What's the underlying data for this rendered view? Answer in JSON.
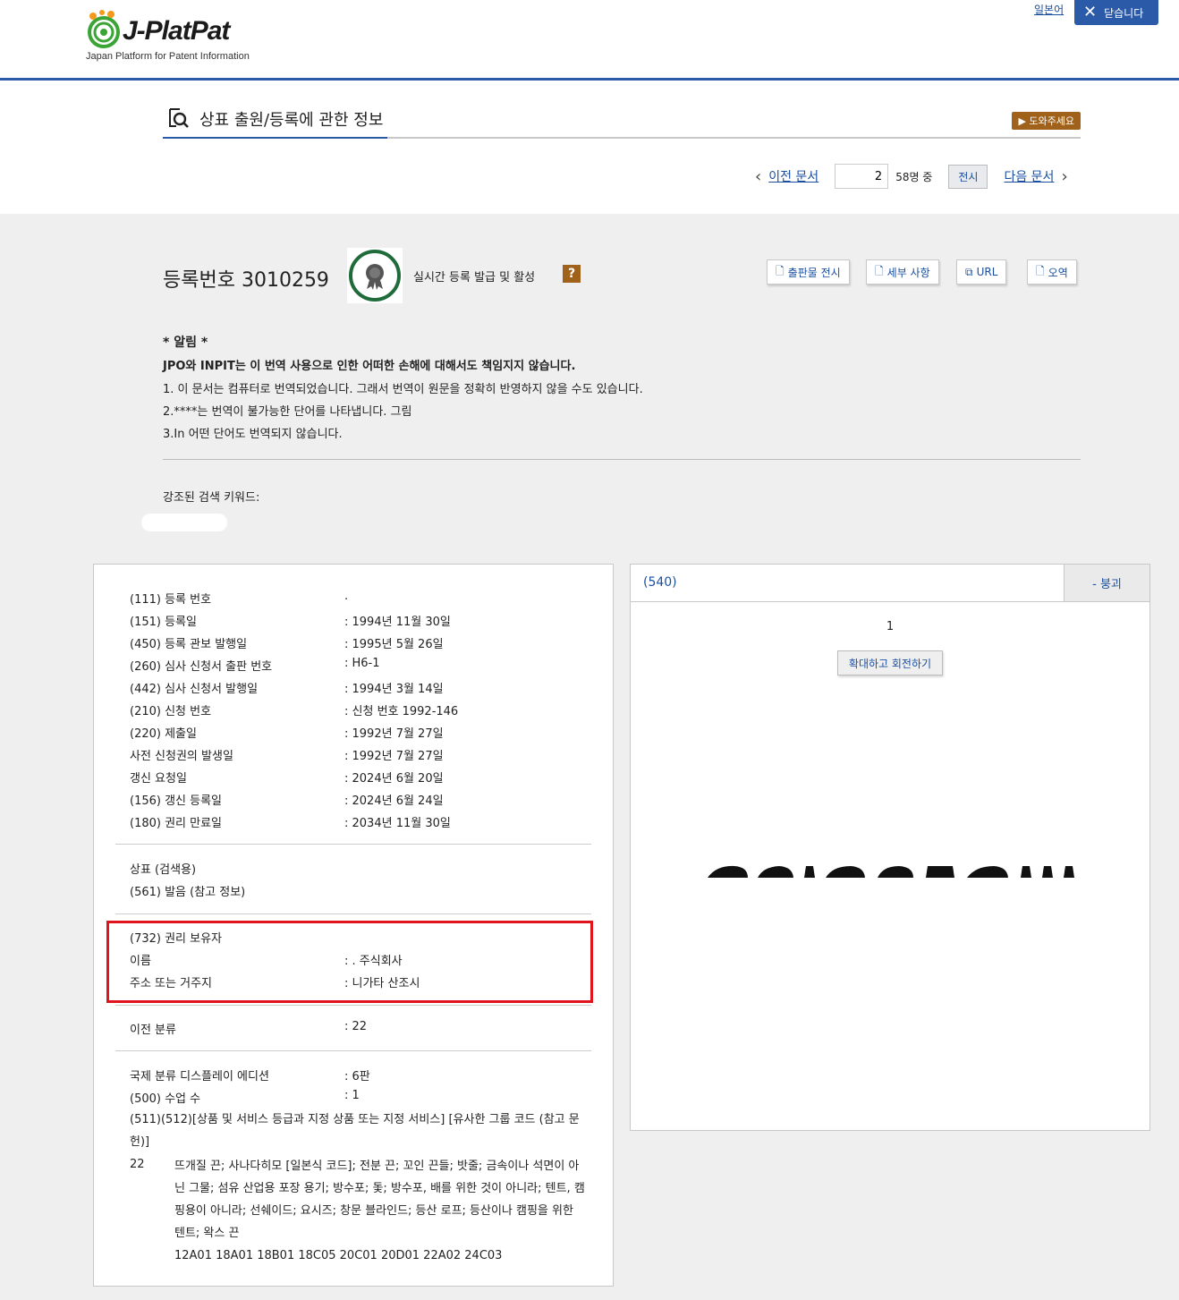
{
  "header": {
    "logo_text": "J-PlatPat",
    "logo_subtitle": "Japan Platform for Patent Information",
    "lang_link": "일본어",
    "close_label": "닫습니다"
  },
  "page": {
    "title": "상표 출원/등록에 관한 정보",
    "help_label": "▶ 도와주세요"
  },
  "pager": {
    "prev_label": "이전 문서",
    "current": "2",
    "of_label": "58명 중",
    "show_label": "전시",
    "next_label": "다음 문서"
  },
  "record": {
    "registration_title": "등록번호 3010259",
    "live_text": "실시간 등록 발급 및 활성",
    "q_mark": "?",
    "actions": [
      "출판물 전시",
      "세부 사항",
      "URL",
      "오역"
    ]
  },
  "notice": {
    "heading": "* 알림 *",
    "bold_line": "JPO와 INPIT는 이 번역 사용으로 인한 어떠한 손해에 대해서도 책임지지 않습니다.",
    "lines": [
      "1. 이 문서는 컴퓨터로 번역되었습니다. 그래서 번역이 원문을 정확히 반영하지 않을 수도 있습니다.",
      "2.****는 번역이 불가능한 단어를 나타냅니다. 그림",
      "3.In 어떤 단어도 번역되지 않습니다."
    ]
  },
  "keywords": {
    "label": "강조된 검색 키워드:"
  },
  "details": {
    "rows": [
      {
        "label": "(111) 등록 번호",
        "value": "."
      },
      {
        "label": "(151) 등록일",
        "value": ": 1994년 11월 30일"
      },
      {
        "label": "(450) 등록 관보 발행일",
        "value": ": 1995년 5월 26일"
      },
      {
        "label": "(260) 심사 신청서 출판 번호",
        "value": ": H6-1"
      },
      {
        "label": "(442) 심사 신청서 발행일",
        "value": ": 1994년 3월 14일"
      },
      {
        "label": "(210) 신청 번호",
        "value": ": 신청 번호 1992-146"
      },
      {
        "label": "(220) 제출일",
        "value": ": 1992년 7월 27일"
      },
      {
        "label": "사전 신청권의 발생일",
        "value": ": 1992년 7월 27일"
      },
      {
        "label": "갱신 요청일",
        "value": ": 2024년 6월 20일"
      },
      {
        "label": "(156) 갱신 등록일",
        "value": ": 2024년 6월 24일"
      },
      {
        "label": "(180) 권리 만료일",
        "value": ": 2034년 11월 30일"
      }
    ],
    "mark_rows": [
      {
        "label": "상표 (검색용)",
        "value": ""
      },
      {
        "label": "(561) 발음 (참고 정보)",
        "value": ""
      }
    ],
    "holder": {
      "heading": "(732) 권리 보유자",
      "name_label": "이름",
      "name_value": ":                    . 주식회사",
      "address_label": "주소 또는 거주지",
      "address_value": ": 니가타 산조시"
    },
    "prior_class": {
      "label": "이전 분류",
      "value": ": 22"
    },
    "intl": [
      {
        "label": "국제 분류 디스플레이 에디션",
        "value": ": 6판"
      },
      {
        "label": "(500) 수업 수",
        "value": ": 1"
      }
    ],
    "goods_heading": "(511)(512)[상품 및 서비스 등급과 지정 상품 또는 지정 서비스] [유사한 그룹 코드 (참고 문헌)]",
    "class_no": "22",
    "goods_text": "뜨개질 끈; 사나다히모 [일본식 코드]; 전분 끈; 꼬인 끈들; 밧줄; 금속이나 석면이 아닌 그물; 섬유 산업용 포장 용기; 방수포; 돛; 방수포, 배를 위한 것이 아니라; 텐트, 캠핑용이 아니라; 선쉐이드; 요시즈; 창문 블라인드; 등산 로프; 등산이나 캠핑을 위한 텐트; 왁스 끈",
    "group_codes": "12A01 18A01 18B01 18C05 20C01 20D01 22A02 24C03"
  },
  "image_panel": {
    "code": "(540)",
    "collapse_label": "- 붕괴",
    "page_num": "1",
    "zoom_label": "확대하고 회전하기"
  }
}
